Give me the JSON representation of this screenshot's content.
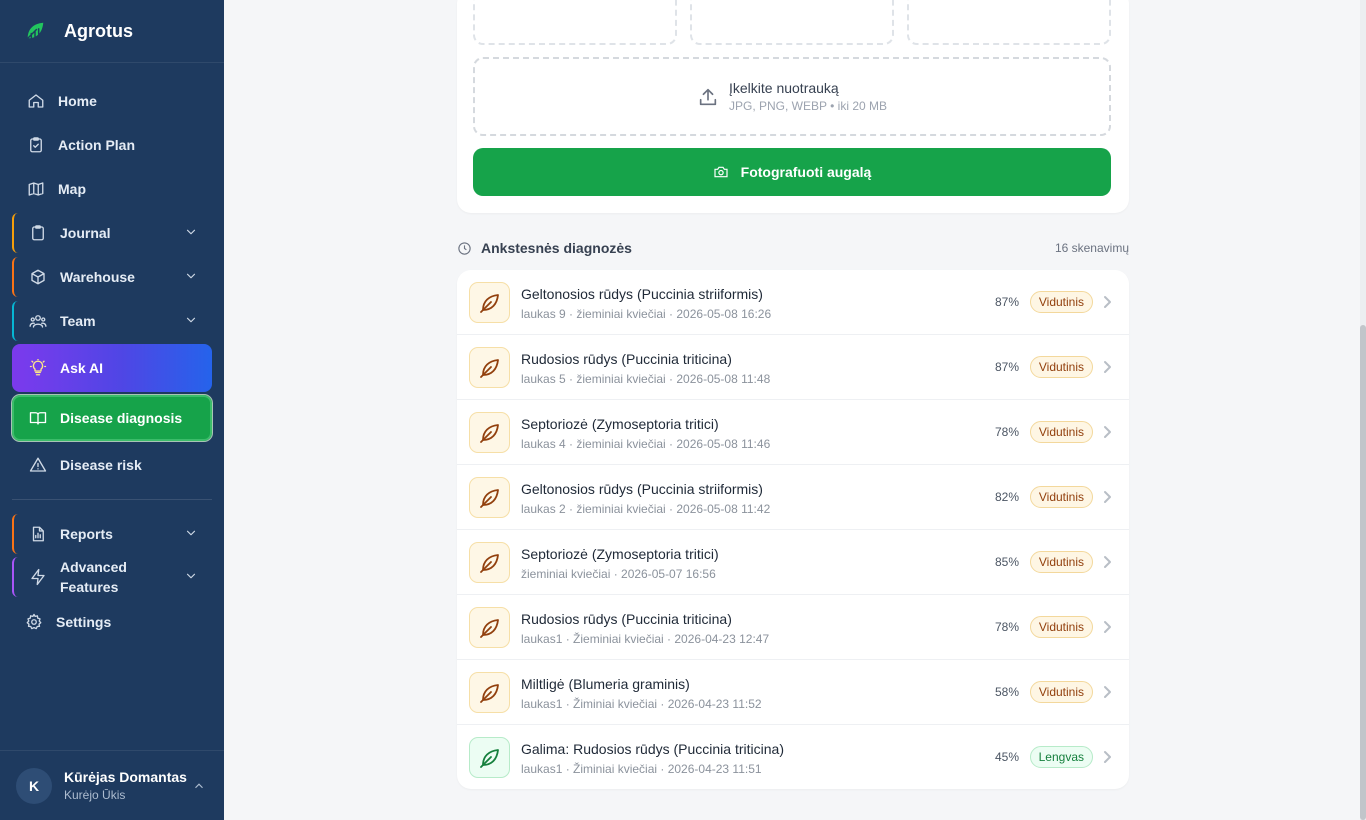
{
  "brand": {
    "name": "Agrotus"
  },
  "sidebar": {
    "items": [
      {
        "label": "Home"
      },
      {
        "label": "Action Plan"
      },
      {
        "label": "Map"
      },
      {
        "label": "Journal"
      },
      {
        "label": "Warehouse"
      },
      {
        "label": "Team"
      },
      {
        "label": "Ask AI"
      },
      {
        "label": "Disease diagnosis"
      },
      {
        "label": "Disease risk"
      },
      {
        "label": "Reports"
      },
      {
        "label": "Advanced Features"
      },
      {
        "label": "Settings"
      }
    ],
    "accent_colors": {
      "journal": "#f59e0b",
      "warehouse": "#f97316",
      "team": "#06b6d4",
      "reports": "#f97316",
      "advanced": "#a855f7"
    }
  },
  "user": {
    "initial": "K",
    "name": "Kūrėjas Domantas",
    "farm": "Kurėjo Ūkis"
  },
  "upload": {
    "title": "Įkelkite nuotrauką",
    "hint": "JPG, PNG, WEBP • iki 20 MB"
  },
  "photo_button": {
    "label": "Fotografuoti augalą"
  },
  "history": {
    "title": "Ankstesnės diagnozės",
    "count": "16 skenavimų",
    "rows": [
      {
        "title": "Geltonosios rūdys (Puccinia striiformis)",
        "meta": "laukas 9 · žieminiai kviečiai · 2026-05-08 16:26",
        "pct": "87%",
        "badge": "Vidutinis",
        "level": "medium"
      },
      {
        "title": "Rudosios rūdys (Puccinia triticina)",
        "meta": "laukas 5 · žieminiai kviečiai · 2026-05-08 11:48",
        "pct": "87%",
        "badge": "Vidutinis",
        "level": "medium"
      },
      {
        "title": "Septoriozė (Zymoseptoria tritici)",
        "meta": "laukas 4 · žieminiai kviečiai · 2026-05-08 11:46",
        "pct": "78%",
        "badge": "Vidutinis",
        "level": "medium"
      },
      {
        "title": "Geltonosios rūdys (Puccinia striiformis)",
        "meta": "laukas 2 · žieminiai kviečiai · 2026-05-08 11:42",
        "pct": "82%",
        "badge": "Vidutinis",
        "level": "medium"
      },
      {
        "title": "Septoriozė (Zymoseptoria tritici)",
        "meta": "žieminiai kviečiai · 2026-05-07 16:56",
        "pct": "85%",
        "badge": "Vidutinis",
        "level": "medium"
      },
      {
        "title": "Rudosios rūdys (Puccinia triticina)",
        "meta": "laukas1 · Žieminiai kviečiai · 2026-04-23 12:47",
        "pct": "78%",
        "badge": "Vidutinis",
        "level": "medium"
      },
      {
        "title": "Miltligė (Blumeria graminis)",
        "meta": "laukas1 · Žiminiai kviečiai · 2026-04-23 11:52",
        "pct": "58%",
        "badge": "Vidutinis",
        "level": "medium"
      },
      {
        "title": "Galima: Rudosios rūdys (Puccinia triticina)",
        "meta": "laukas1 · Žiminiai kviečiai · 2026-04-23 11:51",
        "pct": "45%",
        "badge": "Lengvas",
        "level": "low"
      }
    ]
  }
}
